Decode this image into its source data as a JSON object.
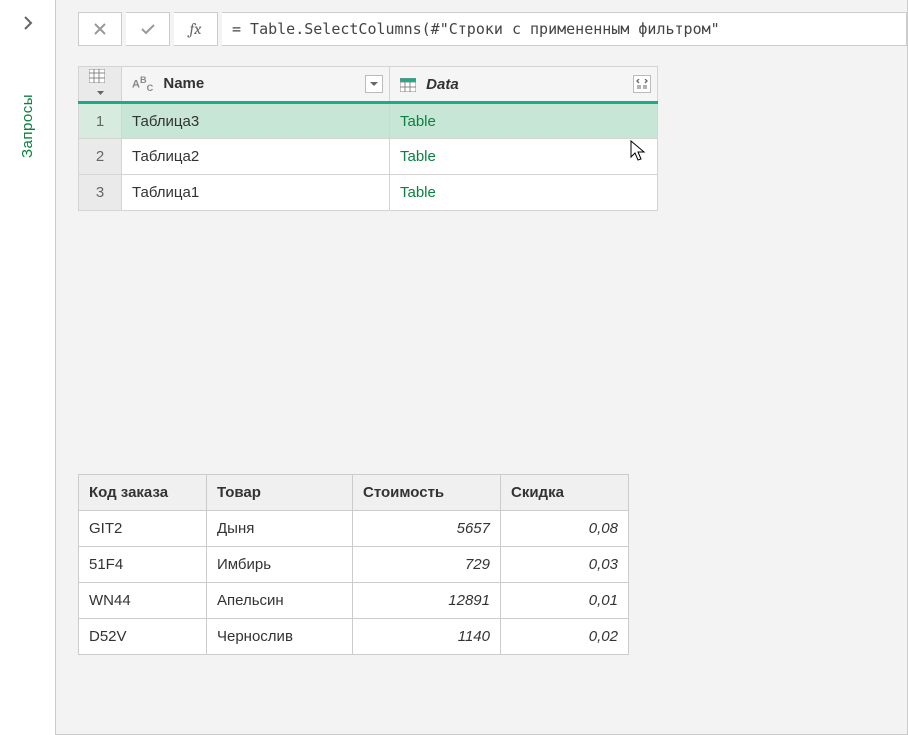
{
  "sidebar": {
    "label": "Запросы"
  },
  "formula_bar": {
    "fx_label": "fx",
    "formula": "= Table.SelectColumns(#\"Строки с примененным фильтром\""
  },
  "grid": {
    "columns": {
      "name": "Name",
      "data": "Data"
    },
    "rows": [
      {
        "idx": "1",
        "name": "Таблица3",
        "data": "Table",
        "selected": true
      },
      {
        "idx": "2",
        "name": "Таблица2",
        "data": "Table",
        "selected": false
      },
      {
        "idx": "3",
        "name": "Таблица1",
        "data": "Table",
        "selected": false
      }
    ]
  },
  "preview": {
    "headers": {
      "kod": "Код заказа",
      "tovar": "Товар",
      "stoimost": "Стоимость",
      "skidka": "Скидка"
    },
    "rows": [
      {
        "kod": "GIT2",
        "tovar": "Дыня",
        "stoimost": "5657",
        "skidka": "0,08"
      },
      {
        "kod": "51F4",
        "tovar": "Имбирь",
        "stoimost": "729",
        "skidka": "0,03"
      },
      {
        "kod": "WN44",
        "tovar": "Апельсин",
        "stoimost": "12891",
        "skidka": "0,01"
      },
      {
        "kod": "D52V",
        "tovar": "Чернослив",
        "stoimost": "1140",
        "skidka": "0,02"
      }
    ]
  }
}
